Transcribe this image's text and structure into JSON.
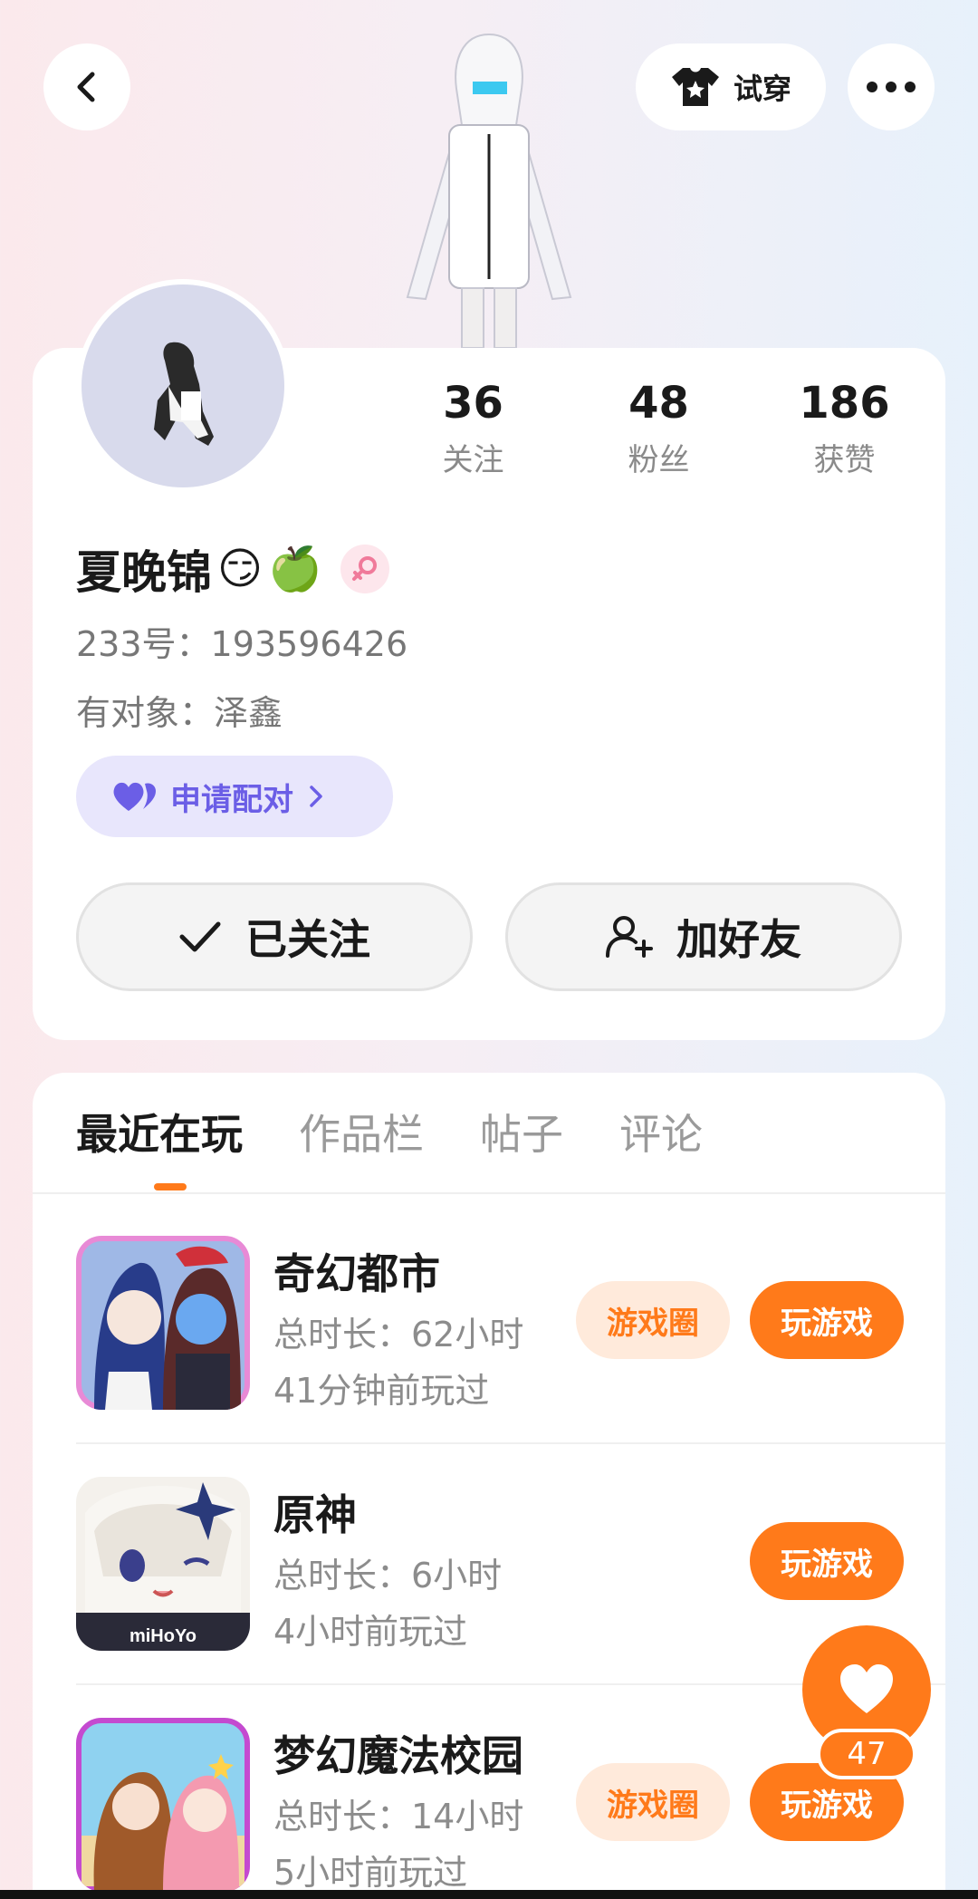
{
  "header": {
    "back_icon": "chevron-left-icon",
    "tryon_label": "试穿",
    "tryon_icon": "tshirt-icon",
    "more_icon": "more-dots-icon"
  },
  "profile": {
    "stats": [
      {
        "value": "36",
        "label": "关注"
      },
      {
        "value": "48",
        "label": "粉丝"
      },
      {
        "value": "186",
        "label": "获赞"
      }
    ],
    "name": "夏晚锦",
    "emoji1": "😏",
    "emoji2": "🍏",
    "gender_icon": "female-icon",
    "id_text": "233号：193596426",
    "partner_text": "有对象：泽鑫",
    "pair_label": "申请配对",
    "follow_label": "已关注",
    "add_friend_label": "加好友"
  },
  "tabs": [
    {
      "label": "最近在玩",
      "active": true
    },
    {
      "label": "作品栏",
      "active": false
    },
    {
      "label": "帖子",
      "active": false
    },
    {
      "label": "评论",
      "active": false
    }
  ],
  "games": [
    {
      "title": "奇幻都市",
      "duration": "总时长：62小时",
      "last_played": "41分钟前玩过",
      "circle_label": "游戏圈",
      "play_label": "玩游戏"
    },
    {
      "title": "原神",
      "duration": "总时长：6小时",
      "last_played": "4小时前玩过",
      "play_label": "玩游戏",
      "icon_text": "miHoYo"
    },
    {
      "title": "梦幻魔法校园",
      "duration": "总时长：14小时",
      "last_played": "5小时前玩过",
      "circle_label": "游戏圈",
      "play_label": "玩游戏"
    }
  ],
  "like_fab": {
    "count": "47",
    "icon": "heart-icon"
  },
  "colors": {
    "accent": "#ff7a1a",
    "pair_purple": "#6b5ee6"
  }
}
